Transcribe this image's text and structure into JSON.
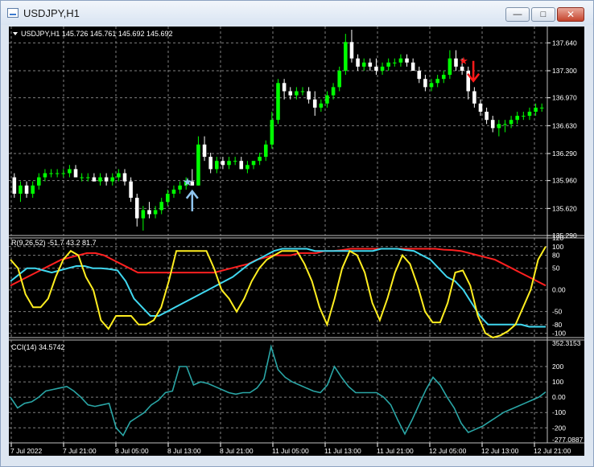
{
  "window": {
    "title": "USDJPY,H1",
    "minimize_glyph": "—",
    "maximize_glyph": "□",
    "close_glyph": "✕"
  },
  "colors": {
    "background": "#000000",
    "grid": "#7f7f7f",
    "bull_candle": "#00ff00",
    "bear_candle": "#ffffff",
    "rsi_fast": "#ff2020",
    "rsi_mid": "#40d8f0",
    "rsi_slow": "#ffee20",
    "cci": "#2aa6a6",
    "buy_arrow": "#8fc4ee",
    "sell_arrow": "#ff1a1a"
  },
  "icons": {
    "chart_menu": "triangle-down-icon",
    "buy_signal": "arrow-up-icon",
    "sell_signal": "arrow-down-icon"
  },
  "main_panel": {
    "legend": "USDJPY,H1  145.726 145.761 145.692 145.692",
    "price_labels": [
      "137.640",
      "137.300",
      "136.970",
      "136.630",
      "136.290",
      "135.960",
      "135.620",
      "135.290"
    ]
  },
  "rsi_panel": {
    "legend": "R(9,26,52) -51.7 43.2 81.7",
    "level_labels": [
      "120",
      "100",
      "80",
      "50",
      "0.00",
      "-50",
      "-80",
      "-100"
    ]
  },
  "cci_panel": {
    "legend": "CCI(14) 34.5742",
    "level_labels": [
      "352.3153",
      "200",
      "100",
      "0.00",
      "-100",
      "-200",
      "-277.0887"
    ]
  },
  "time_labels": [
    "7 Jul 2022",
    "7 Jul 21:00",
    "8 Jul 05:00",
    "8 Jul 13:00",
    "8 Jul 21:00",
    "11 Jul 05:00",
    "11 Jul 13:00",
    "11 Jul 21:00",
    "12 Jul 05:00",
    "12 Jul 13:00",
    "12 Jul 21:00"
  ],
  "chart_data": [
    {
      "type": "candlestick",
      "symbol": "USDJPY",
      "timeframe": "H1",
      "ylim": [
        135.29,
        137.8
      ],
      "ohlc": [
        [
          136.0,
          136.05,
          135.75,
          135.8
        ],
        [
          135.8,
          135.95,
          135.7,
          135.9
        ],
        [
          135.9,
          135.95,
          135.75,
          135.8
        ],
        [
          135.8,
          135.95,
          135.75,
          135.9
        ],
        [
          135.9,
          136.05,
          135.85,
          136.0
        ],
        [
          136.0,
          136.1,
          135.95,
          136.05
        ],
        [
          136.05,
          136.1,
          136.0,
          136.05
        ],
        [
          136.05,
          136.1,
          136.0,
          136.05
        ],
        [
          136.05,
          136.1,
          136.0,
          136.05
        ],
        [
          136.05,
          136.15,
          136.0,
          136.1
        ],
        [
          136.1,
          136.15,
          136.0,
          136.0
        ],
        [
          136.0,
          136.05,
          135.95,
          136.0
        ],
        [
          136.0,
          136.05,
          135.95,
          136.0
        ],
        [
          136.0,
          136.05,
          135.95,
          135.95
        ],
        [
          135.95,
          136.05,
          135.9,
          136.0
        ],
        [
          136.0,
          136.05,
          135.9,
          135.95
        ],
        [
          135.95,
          136.05,
          135.9,
          136.0
        ],
        [
          136.0,
          136.1,
          135.95,
          136.05
        ],
        [
          136.05,
          136.1,
          135.9,
          135.95
        ],
        [
          135.95,
          136.0,
          135.7,
          135.75
        ],
        [
          135.75,
          135.8,
          135.4,
          135.5
        ],
        [
          135.5,
          135.65,
          135.35,
          135.6
        ],
        [
          135.6,
          135.7,
          135.5,
          135.55
        ],
        [
          135.55,
          135.65,
          135.5,
          135.6
        ],
        [
          135.6,
          135.75,
          135.55,
          135.7
        ],
        [
          135.7,
          135.85,
          135.65,
          135.8
        ],
        [
          135.8,
          135.9,
          135.75,
          135.85
        ],
        [
          135.85,
          135.95,
          135.8,
          135.9
        ],
        [
          135.9,
          136.0,
          135.85,
          135.95
        ],
        [
          135.95,
          136.1,
          135.9,
          135.9
        ],
        [
          135.9,
          136.5,
          135.9,
          136.4
        ],
        [
          136.4,
          136.5,
          136.2,
          136.25
        ],
        [
          136.25,
          136.3,
          136.05,
          136.1
        ],
        [
          136.1,
          136.25,
          136.05,
          136.2
        ],
        [
          136.2,
          136.25,
          136.1,
          136.15
        ],
        [
          136.15,
          136.25,
          136.1,
          136.2
        ],
        [
          136.2,
          136.25,
          136.15,
          136.2
        ],
        [
          136.2,
          136.25,
          136.1,
          136.1
        ],
        [
          136.1,
          136.2,
          136.05,
          136.15
        ],
        [
          136.15,
          136.2,
          136.1,
          136.2
        ],
        [
          136.2,
          136.3,
          136.15,
          136.25
        ],
        [
          136.25,
          136.45,
          136.2,
          136.4
        ],
        [
          136.4,
          136.8,
          136.35,
          136.7
        ],
        [
          136.7,
          137.2,
          136.65,
          137.15
        ],
        [
          137.15,
          137.2,
          136.95,
          137.05
        ],
        [
          137.05,
          137.1,
          136.95,
          137.0
        ],
        [
          137.0,
          137.1,
          136.95,
          137.05
        ],
        [
          137.05,
          137.1,
          137.0,
          137.05
        ],
        [
          137.05,
          137.1,
          136.9,
          136.95
        ],
        [
          136.95,
          137.05,
          136.75,
          136.85
        ],
        [
          136.85,
          136.95,
          136.8,
          136.9
        ],
        [
          136.9,
          137.05,
          136.85,
          137.0
        ],
        [
          137.0,
          137.15,
          136.95,
          137.1
        ],
        [
          137.1,
          137.35,
          137.05,
          137.3
        ],
        [
          137.3,
          137.75,
          137.25,
          137.65
        ],
        [
          137.65,
          137.8,
          137.4,
          137.45
        ],
        [
          137.45,
          137.5,
          137.3,
          137.35
        ],
        [
          137.35,
          137.45,
          137.3,
          137.4
        ],
        [
          137.4,
          137.45,
          137.3,
          137.35
        ],
        [
          137.35,
          137.45,
          137.25,
          137.3
        ],
        [
          137.3,
          137.4,
          137.25,
          137.35
        ],
        [
          137.35,
          137.45,
          137.3,
          137.4
        ],
        [
          137.4,
          137.45,
          137.35,
          137.4
        ],
        [
          137.4,
          137.5,
          137.35,
          137.45
        ],
        [
          137.45,
          137.5,
          137.35,
          137.4
        ],
        [
          137.4,
          137.45,
          137.3,
          137.3
        ],
        [
          137.3,
          137.35,
          137.15,
          137.2
        ],
        [
          137.2,
          137.25,
          137.05,
          137.1
        ],
        [
          137.1,
          137.2,
          137.05,
          137.15
        ],
        [
          137.15,
          137.25,
          137.1,
          137.2
        ],
        [
          137.2,
          137.3,
          137.15,
          137.25
        ],
        [
          137.25,
          137.55,
          137.2,
          137.45
        ],
        [
          137.45,
          137.55,
          137.3,
          137.35
        ],
        [
          137.35,
          137.45,
          137.25,
          137.3
        ],
        [
          137.3,
          137.35,
          136.95,
          137.05
        ],
        [
          137.05,
          137.1,
          136.85,
          136.9
        ],
        [
          136.9,
          136.95,
          136.75,
          136.8
        ],
        [
          136.8,
          136.85,
          136.65,
          136.7
        ],
        [
          136.7,
          136.75,
          136.55,
          136.6
        ],
        [
          136.6,
          136.7,
          136.5,
          136.65
        ],
        [
          136.65,
          136.7,
          136.55,
          136.65
        ],
        [
          136.65,
          136.75,
          136.6,
          136.7
        ],
        [
          136.7,
          136.8,
          136.65,
          136.75
        ],
        [
          136.75,
          136.8,
          136.7,
          136.75
        ],
        [
          136.75,
          136.85,
          136.7,
          136.8
        ],
        [
          136.8,
          136.9,
          136.75,
          136.85
        ],
        [
          136.85,
          136.9,
          136.8,
          136.85
        ]
      ],
      "signals": [
        {
          "type": "buy",
          "bar": 29,
          "price": 135.88
        },
        {
          "type": "sell",
          "bar": 73,
          "price": 137.4
        }
      ]
    },
    {
      "type": "line",
      "indicator": "R(9,26,52)",
      "ylim": [
        -110,
        120
      ],
      "series": [
        {
          "values": [
            70,
            50,
            -10,
            -40,
            -40,
            -20,
            30,
            70,
            90,
            80,
            30,
            0,
            -70,
            -90,
            -60,
            -60,
            -60,
            -80,
            -80,
            -70,
            -40,
            20,
            90,
            90,
            90,
            90,
            90,
            50,
            0,
            -20,
            -50,
            -20,
            20,
            50,
            70,
            80,
            90,
            90,
            90,
            60,
            20,
            -40,
            -80,
            -20,
            50,
            90,
            80,
            40,
            -30,
            -70,
            -20,
            40,
            80,
            60,
            10,
            -50,
            -75,
            -75,
            -30,
            40,
            45,
            10,
            -60,
            -100,
            -110,
            -105,
            -95,
            -80,
            -40,
            0,
            70,
            100
          ]
        },
        {
          "values": [
            20,
            35,
            50,
            50,
            45,
            40,
            45,
            50,
            55,
            55,
            50,
            50,
            48,
            45,
            20,
            -20,
            -40,
            -60,
            -60,
            -50,
            -40,
            -30,
            -20,
            -10,
            0,
            10,
            20,
            30,
            45,
            60,
            70,
            80,
            90,
            95,
            95,
            95,
            95,
            90,
            90,
            90,
            90,
            90,
            90,
            90,
            90,
            95,
            95,
            95,
            92,
            90,
            80,
            70,
            50,
            30,
            20,
            0,
            -30,
            -60,
            -80,
            -80,
            -80,
            -80,
            -80,
            -85,
            -85,
            -85
          ]
        },
        {
          "values": [
            10,
            20,
            30,
            40,
            50,
            60,
            70,
            75,
            80,
            85,
            85,
            80,
            70,
            60,
            50,
            40,
            40,
            40,
            40,
            40,
            40,
            40,
            40,
            40,
            40,
            45,
            50,
            55,
            60,
            70,
            75,
            80,
            80,
            80,
            85,
            85,
            85,
            90,
            90,
            92,
            95,
            95,
            95,
            95,
            95,
            95,
            95,
            95,
            95,
            95,
            95,
            93,
            92,
            90,
            85,
            80,
            75,
            70,
            60,
            50,
            40,
            30,
            20,
            10
          ]
        }
      ]
    },
    {
      "type": "line",
      "indicator": "CCI(14)",
      "ylim": [
        -277.0887,
        352.3153
      ],
      "series": [
        {
          "values": [
            0,
            -70,
            -40,
            -30,
            0,
            40,
            50,
            60,
            70,
            40,
            0,
            -50,
            -60,
            -50,
            -40,
            -200,
            -250,
            -160,
            -130,
            -100,
            -50,
            -20,
            30,
            40,
            200,
            200,
            80,
            100,
            90,
            70,
            50,
            30,
            20,
            30,
            30,
            60,
            120,
            330,
            180,
            130,
            100,
            80,
            60,
            40,
            30,
            80,
            200,
            130,
            70,
            30,
            30,
            30,
            30,
            0,
            -50,
            -150,
            -240,
            -150,
            -50,
            50,
            130,
            80,
            0,
            -70,
            -170,
            -230,
            -210,
            -190,
            -160,
            -130,
            -100,
            -80,
            -60,
            -40,
            -20,
            0,
            34.57
          ]
        }
      ]
    }
  ]
}
